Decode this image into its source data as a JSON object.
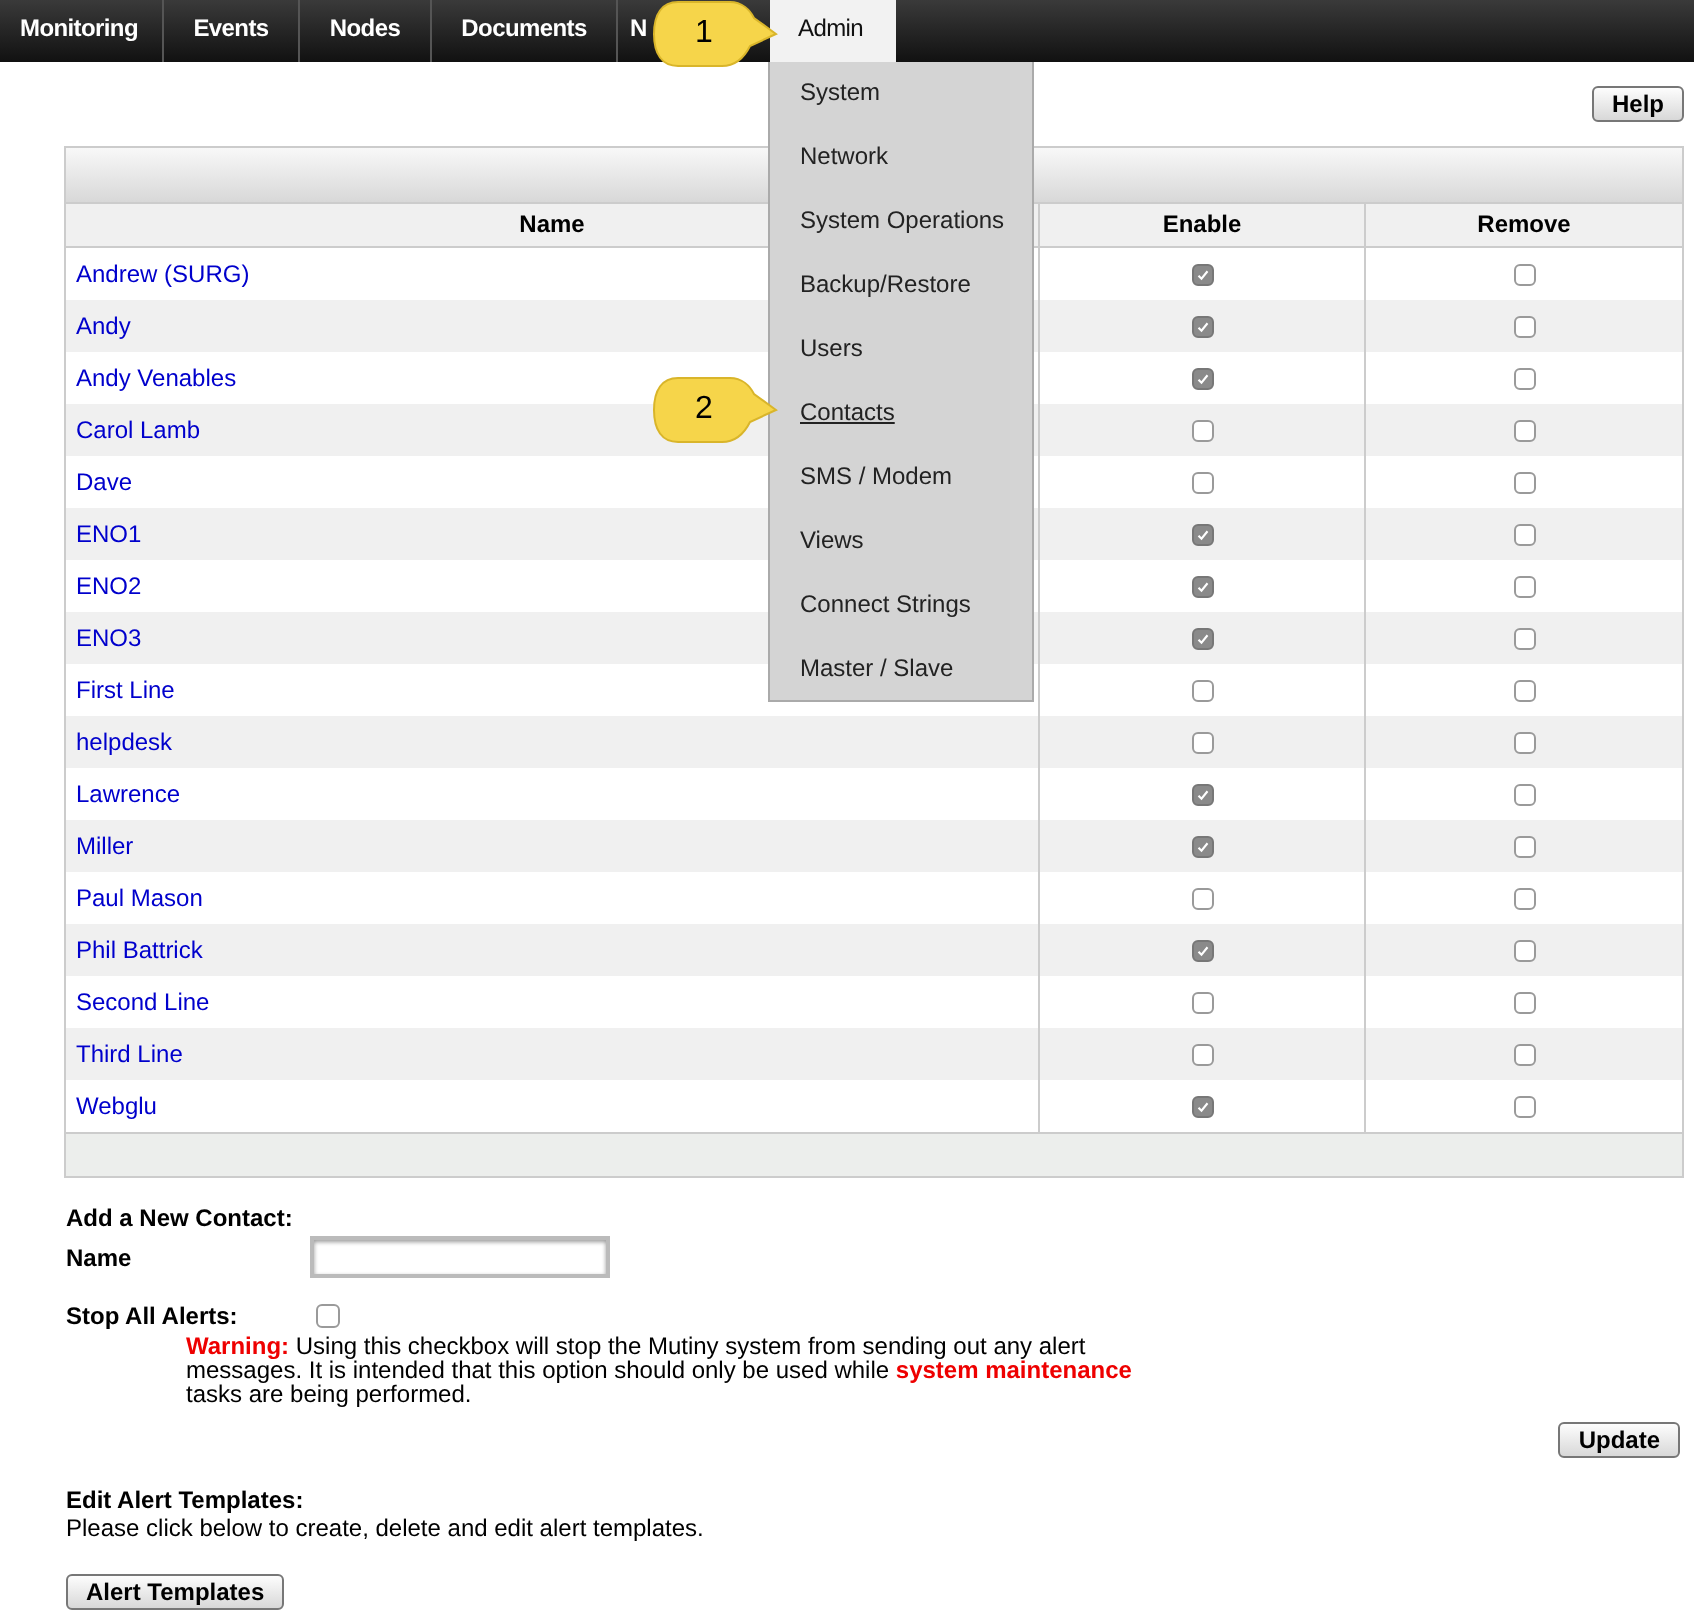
{
  "nav": {
    "tabs": [
      {
        "label": "Monitoring",
        "selected": false
      },
      {
        "label": "Events",
        "selected": false
      },
      {
        "label": "Nodes",
        "selected": false
      },
      {
        "label": "Documents",
        "selected": false
      },
      {
        "label": "N",
        "selected": false
      },
      {
        "label": "Admin",
        "selected": true
      }
    ],
    "menu": [
      {
        "label": "System",
        "selected": false
      },
      {
        "label": "Network",
        "selected": false
      },
      {
        "label": "System Operations",
        "selected": false
      },
      {
        "label": "Backup/Restore",
        "selected": false
      },
      {
        "label": "Users",
        "selected": false
      },
      {
        "label": "Contacts",
        "selected": true
      },
      {
        "label": "SMS / Modem",
        "selected": false
      },
      {
        "label": "Views",
        "selected": false
      },
      {
        "label": "Connect Strings",
        "selected": false
      },
      {
        "label": "Master / Slave",
        "selected": false
      }
    ]
  },
  "callouts": [
    "1",
    "2"
  ],
  "help_button": "Help",
  "table": {
    "columns": [
      "Name",
      "Enable",
      "Remove"
    ],
    "rows": [
      {
        "name": "Andrew (SURG)",
        "enable": true,
        "remove": false
      },
      {
        "name": "Andy",
        "enable": true,
        "remove": false
      },
      {
        "name": "Andy Venables",
        "enable": true,
        "remove": false
      },
      {
        "name": "Carol Lamb",
        "enable": false,
        "remove": false
      },
      {
        "name": "Dave",
        "enable": false,
        "remove": false
      },
      {
        "name": "ENO1",
        "enable": true,
        "remove": false
      },
      {
        "name": "ENO2",
        "enable": true,
        "remove": false
      },
      {
        "name": "ENO3",
        "enable": true,
        "remove": false
      },
      {
        "name": "First Line",
        "enable": false,
        "remove": false
      },
      {
        "name": "helpdesk",
        "enable": false,
        "remove": false
      },
      {
        "name": "Lawrence",
        "enable": true,
        "remove": false
      },
      {
        "name": "Miller",
        "enable": true,
        "remove": false
      },
      {
        "name": "Paul Mason",
        "enable": false,
        "remove": false
      },
      {
        "name": "Phil Battrick",
        "enable": true,
        "remove": false
      },
      {
        "name": "Second Line",
        "enable": false,
        "remove": false
      },
      {
        "name": "Third Line",
        "enable": false,
        "remove": false
      },
      {
        "name": "Webglu",
        "enable": true,
        "remove": false
      }
    ]
  },
  "add_contact": {
    "heading": "Add a New Contact:",
    "name_label": "Name"
  },
  "stop_alerts": {
    "label": "Stop All Alerts:",
    "checked": false,
    "warning": "**Warning:** Using this checkbox will stop the Mutiny system from sending out any alert messages. It is intended that this option should only be used while **system maintenance** tasks are being performed."
  },
  "update_button": "Update",
  "templates": {
    "heading": "Edit Alert Templates:",
    "text": "Please click below to create, delete and edit alert templates.",
    "button": "Alert Templates"
  }
}
